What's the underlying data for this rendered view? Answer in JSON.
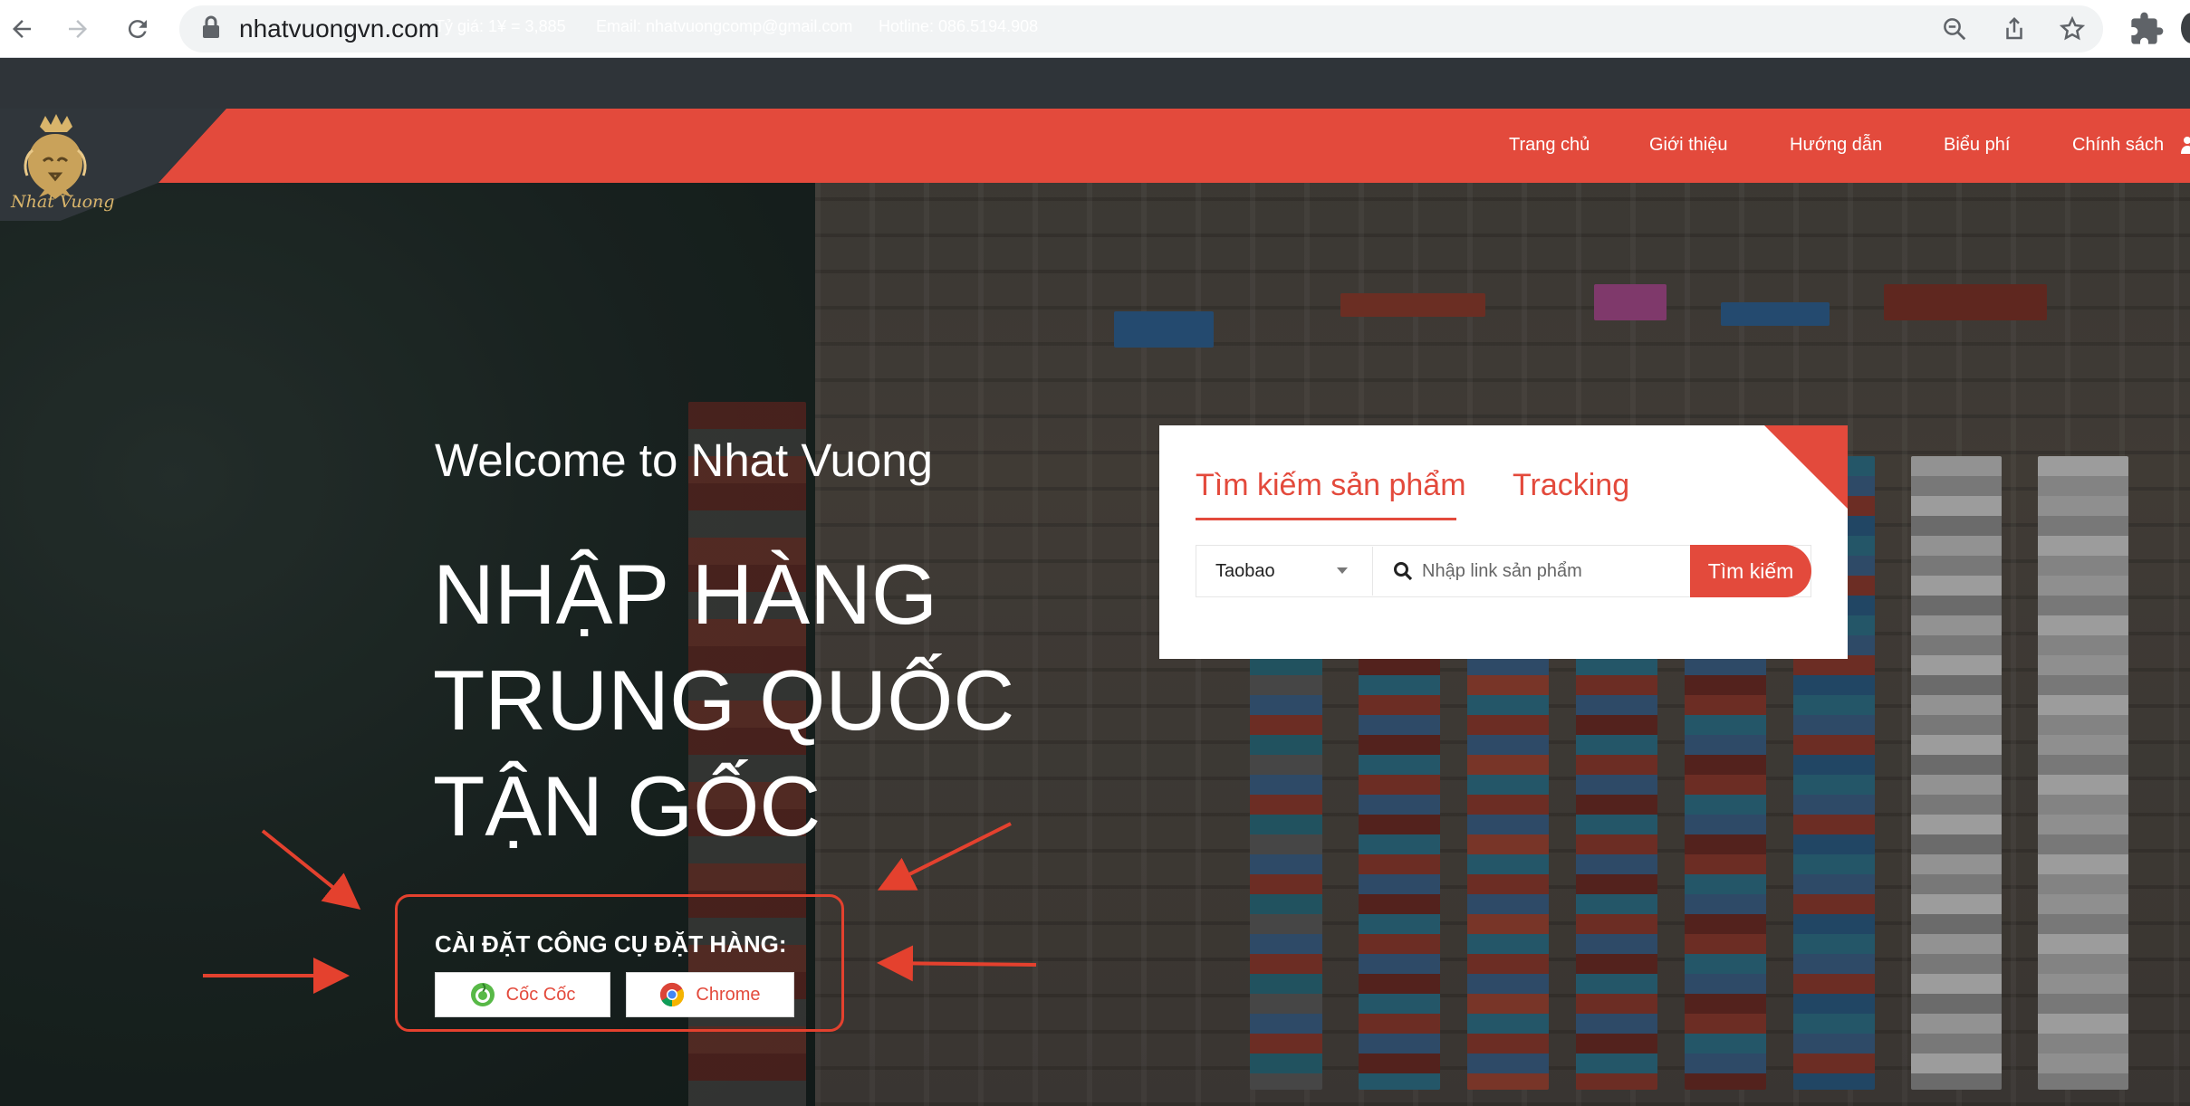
{
  "browser": {
    "url": "nhatvuongvn.com",
    "icons": [
      "back-icon",
      "forward-icon",
      "reload-icon",
      "lock-icon",
      "zoom-icon",
      "share-icon",
      "bookmark-star-icon",
      "extensions-icon"
    ]
  },
  "info_bar": {
    "exchange_rate": "Tỷ giá: 1¥ = 3,885",
    "email": "Email: nhatvuongcomp@gmail.com",
    "hotline": "Hotline: 086.5194.908"
  },
  "logo": {
    "text": "Nhat Vuong",
    "icon": "lion-crown-logo"
  },
  "nav": {
    "items": [
      {
        "label": "Trang chủ"
      },
      {
        "label": "Giới thiệu"
      },
      {
        "label": "Hướng dẫn"
      },
      {
        "label": "Biểu phí"
      },
      {
        "label": "Chính sách"
      }
    ]
  },
  "hero": {
    "welcome": "Welcome to Nhat Vuong",
    "headline_lines": [
      "NHẬP HÀNG",
      "TRUNG QUỐC",
      "TẬN GỐC"
    ],
    "tool_title": "CÀI ĐẶT CÔNG CỤ ĐẶT HÀNG:",
    "tool_buttons": [
      {
        "label": "Cốc Cốc",
        "icon": "coccoc-icon"
      },
      {
        "label": "Chrome",
        "icon": "chrome-icon"
      }
    ]
  },
  "search_card": {
    "tabs": [
      {
        "label": "Tìm kiếm sản phẩm",
        "active": true
      },
      {
        "label": "Tracking",
        "active": false
      }
    ],
    "platform_selected": "Taobao",
    "search_placeholder": "Nhập link sản phẩm",
    "search_button": "Tìm kiếm"
  },
  "colors": {
    "brand_red": "#e34a3c",
    "dark_bar": "#2f3439",
    "annotation_red": "#e4412e",
    "logo_gold": "#d9b56b"
  }
}
